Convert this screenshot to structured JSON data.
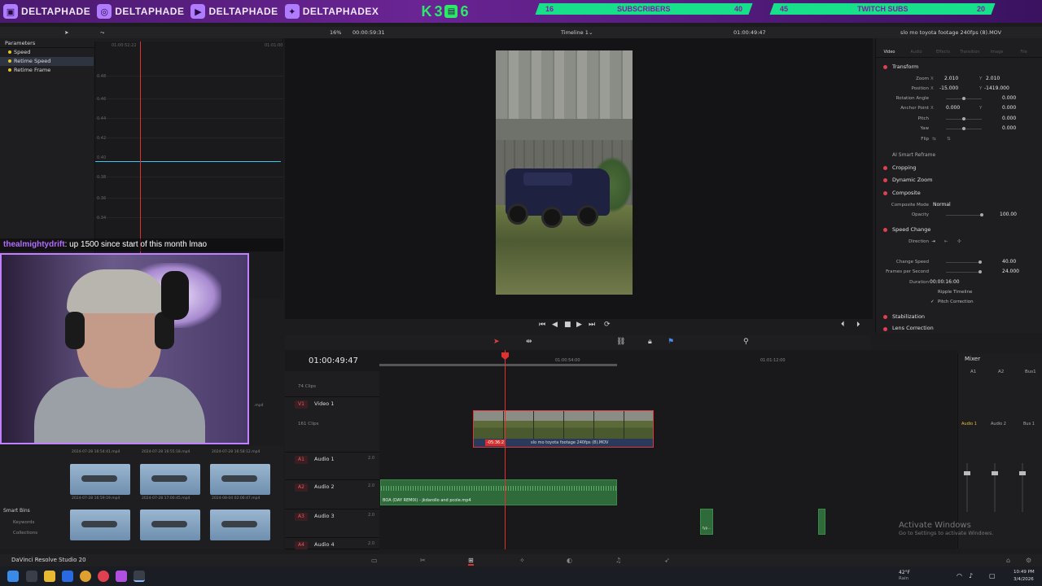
{
  "banner": {
    "socials": [
      {
        "icon": "twitch-icon",
        "name": "DELTAPHADE"
      },
      {
        "icon": "instagram-icon",
        "name": "DELTAPHADE"
      },
      {
        "icon": "youtube-icon",
        "name": "DELTAPHADE"
      },
      {
        "icon": "twitter-icon",
        "name": "DELTAPHADEX"
      }
    ],
    "k_badge": {
      "letter": "K",
      "num1": "3",
      "num2": "6"
    },
    "subscribers": {
      "current": "16",
      "label": "SUBSCRIBERS",
      "goal": "40"
    },
    "twitch_subs": {
      "current": "45",
      "label": "TWITCH SUBS",
      "goal": "20"
    }
  },
  "toolbar": {
    "zoom": "16%",
    "timecode": "00:00:59:31",
    "timeline_name": "Timeline 1",
    "viewer_tc": "01:00:49:47",
    "clip_name": "slo mo toyota footage 240fps (8).MOV"
  },
  "parameters": {
    "title": "Parameters",
    "items": [
      {
        "label": "Speed",
        "color": "#e8c030"
      },
      {
        "label": "Retime Speed",
        "color": "#e8c030"
      },
      {
        "label": "Retime Frame",
        "color": "#e8c030"
      }
    ],
    "ruler": [
      "01:00:52:22",
      "01:01:00"
    ],
    "y_labels": [
      "0.48",
      "0.46",
      "0.44",
      "0.42",
      "0.40",
      "0.38",
      "0.36",
      "0.34"
    ]
  },
  "chat": {
    "user": "thealmightydrift",
    "message": ": up 1500 since start of this month lmao"
  },
  "inspector": {
    "tabs": [
      "Video",
      "Audio",
      "Effects",
      "Transition",
      "Image",
      "File"
    ],
    "transform": {
      "title": "Transform",
      "zoom_label": "Zoom",
      "zoom_x": "2.010",
      "zoom_y": "2.010",
      "position_label": "Position",
      "pos_x": "-15.000",
      "pos_y": "-1419.000",
      "rotation_label": "Rotation Angle",
      "rotation": "0.000",
      "anchor_label": "Anchor Point",
      "anchor_x": "0.000",
      "anchor_y": "0.000",
      "pitch_label": "Pitch",
      "pitch": "0.000",
      "yaw_label": "Yaw",
      "yaw": "0.000",
      "flip_label": "Flip"
    },
    "ai_reframe": "AI Smart Reframe",
    "cropping": "Cropping",
    "dynamic_zoom": "Dynamic Zoom",
    "composite": {
      "title": "Composite",
      "mode_label": "Composite Mode",
      "mode": "Normal",
      "opacity_label": "Opacity",
      "opacity": "100.00"
    },
    "speed_change": {
      "title": "Speed Change",
      "direction_label": "Direction",
      "change_speed_label": "Change Speed",
      "change_speed": "40.00",
      "fps_label": "Frames per Second",
      "fps": "24.000",
      "duration_label": "Duration",
      "duration": "00:00:16:00",
      "ripple": "Ripple Timeline",
      "pitch": "Pitch Correction"
    },
    "stabilization": "Stabilization",
    "lens_correction": "Lens Correction"
  },
  "timeline": {
    "timecode": "01:00:49:47",
    "ruler": [
      "01:00:54:00",
      "01:01:12:00"
    ],
    "tracks": [
      {
        "tag": "",
        "name": "",
        "sub": "74 Clips"
      },
      {
        "tag": "V1",
        "name": "Video 1",
        "sub": "161 Clips"
      },
      {
        "tag": "A1",
        "name": "Audio 1",
        "vol": "2.0"
      },
      {
        "tag": "A2",
        "name": "Audio 2",
        "vol": "2.0"
      },
      {
        "tag": "A3",
        "name": "Audio 3",
        "vol": "2.0"
      },
      {
        "tag": "A4",
        "name": "Audio 4",
        "vol": "2.0"
      }
    ],
    "video_clip": {
      "speed": "-05:36:2",
      "name": "slo mo toyota footage 240fps (8).MOV"
    },
    "audio_clip": {
      "name": "BOA (DAY REMIX) - jkdarollo and pcole.mp4"
    },
    "small_clip": "typ..."
  },
  "mixer": {
    "title": "Mixer",
    "channels": [
      "A1",
      "A2",
      "Bus1"
    ],
    "labels": [
      "Audio 1",
      "Audio 2",
      "Bus 1"
    ]
  },
  "media_pool": {
    "captions_top": [
      "2024-07-28 16:54:41.mp4",
      "2024-07-28 16:55:18.mp4",
      "2024-07-28 16:58:12.mp4"
    ],
    "captions_mid": [
      "2024-07-28 16:59:19.mp4",
      "2024-07-28 17:00:45.mp4",
      "2024-08-04 02:06:47.mp4"
    ],
    "right_label": ".mp4",
    "smart_bins": "Smart Bins",
    "keywords": "Keywords",
    "collections": "Collections"
  },
  "app_name": "DaVinci Resolve Studio 20",
  "activate": {
    "title": "Activate Windows",
    "sub": "Go to Settings to activate Windows."
  },
  "tray": {
    "weather": "42°F",
    "weather_sub": "Rain",
    "time": "10:49 PM",
    "date": "3/4/2026"
  }
}
